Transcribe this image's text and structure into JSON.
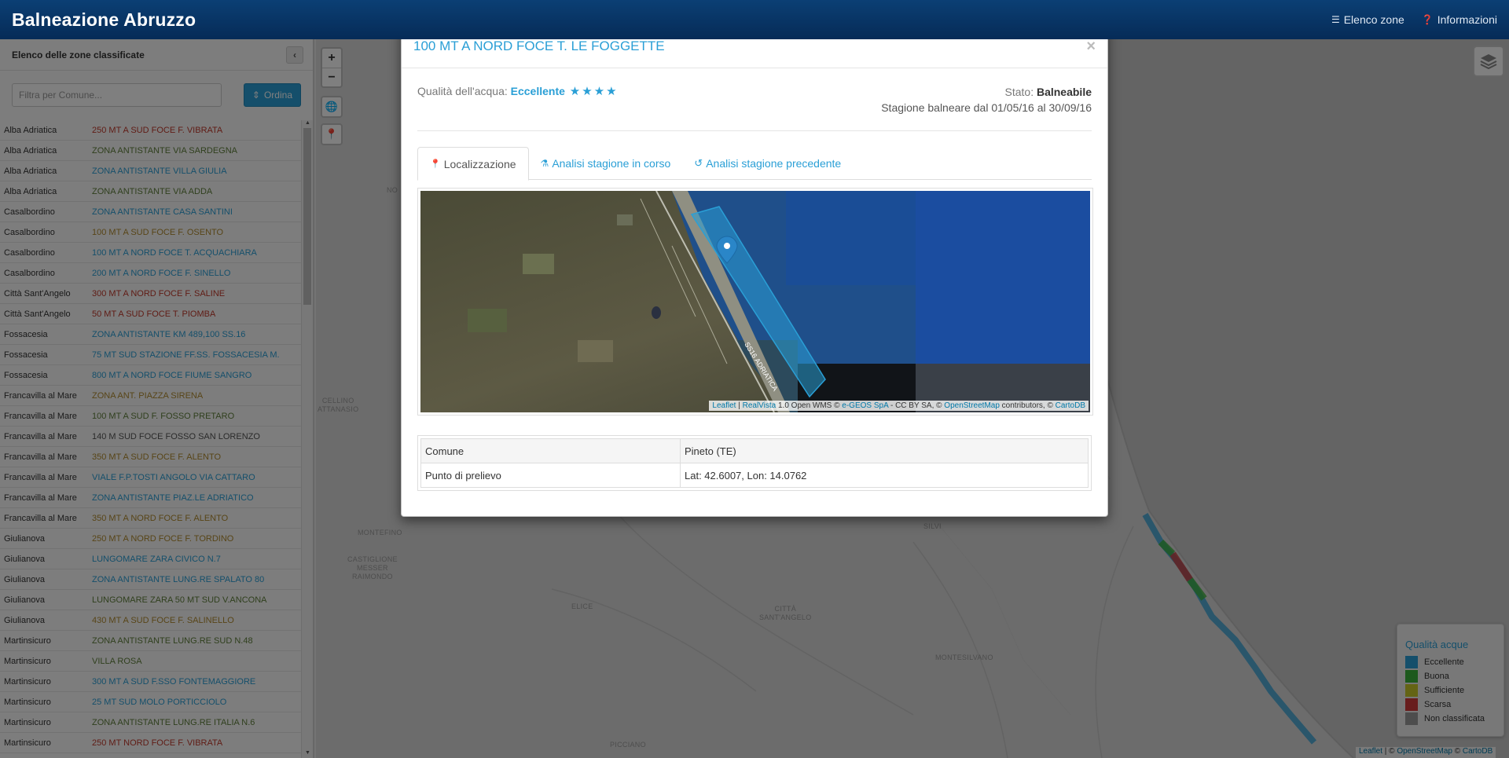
{
  "navbar": {
    "brand": "Balneazione Abruzzo",
    "elenco_zone": "Elenco zone",
    "informazioni": "Informazioni"
  },
  "sidebar": {
    "title": "Elenco delle zone classificate",
    "filter_placeholder": "Filtra per Comune...",
    "sort_label": "Ordina",
    "rows": [
      {
        "comune": "Alba Adriatica",
        "zona": "250 MT A SUD FOCE F. VIBRATA",
        "color": "#c0392b"
      },
      {
        "comune": "Alba Adriatica",
        "zona": "ZONA ANTISTANTE VIA SARDEGNA",
        "color": "#5f7f3a"
      },
      {
        "comune": "Alba Adriatica",
        "zona": "ZONA ANTISTANTE VILLA GIULIA",
        "color": "#2a9fd6"
      },
      {
        "comune": "Alba Adriatica",
        "zona": "ZONA ANTISTANTE VIA ADDA",
        "color": "#5f7f3a"
      },
      {
        "comune": "Casalbordino",
        "zona": "ZONA ANTISTANTE CASA SANTINI",
        "color": "#2a9fd6"
      },
      {
        "comune": "Casalbordino",
        "zona": "100 MT A SUD FOCE F. OSENTO",
        "color": "#b08a2e"
      },
      {
        "comune": "Casalbordino",
        "zona": "100 MT A NORD FOCE T. ACQUACHIARA",
        "color": "#2a9fd6"
      },
      {
        "comune": "Casalbordino",
        "zona": "200 MT A NORD FOCE F. SINELLO",
        "color": "#2a9fd6"
      },
      {
        "comune": "Città Sant'Angelo",
        "zona": "300 MT A NORD FOCE F. SALINE",
        "color": "#c0392b"
      },
      {
        "comune": "Città Sant'Angelo",
        "zona": "50 MT A SUD FOCE T. PIOMBA",
        "color": "#c0392b"
      },
      {
        "comune": "Fossacesia",
        "zona": "ZONA ANTISTANTE KM 489,100 SS.16",
        "color": "#2a9fd6"
      },
      {
        "comune": "Fossacesia",
        "zona": "75 MT SUD STAZIONE FF.SS. FOSSACESIA M.",
        "color": "#2a9fd6"
      },
      {
        "comune": "Fossacesia",
        "zona": "800 MT A NORD FOCE FIUME SANGRO",
        "color": "#2a9fd6"
      },
      {
        "comune": "Francavilla al Mare",
        "zona": "ZONA ANT. PIAZZA SIRENA",
        "color": "#b08a2e"
      },
      {
        "comune": "Francavilla al Mare",
        "zona": "100 MT A SUD F. FOSSO PRETARO",
        "color": "#5f7f3a"
      },
      {
        "comune": "Francavilla al Mare",
        "zona": "140 M SUD FOCE FOSSO SAN LORENZO",
        "color": "#555555"
      },
      {
        "comune": "Francavilla al Mare",
        "zona": "350 MT A SUD FOCE F. ALENTO",
        "color": "#b08a2e"
      },
      {
        "comune": "Francavilla al Mare",
        "zona": "VIALE F.P.TOSTI ANGOLO VIA CATTARO",
        "color": "#2a9fd6"
      },
      {
        "comune": "Francavilla al Mare",
        "zona": "ZONA ANTISTANTE PIAZ.LE ADRIATICO",
        "color": "#2a9fd6"
      },
      {
        "comune": "Francavilla al Mare",
        "zona": "350 MT A NORD FOCE F. ALENTO",
        "color": "#b08a2e"
      },
      {
        "comune": "Giulianova",
        "zona": "250 MT A NORD FOCE F. TORDINO",
        "color": "#b08a2e"
      },
      {
        "comune": "Giulianova",
        "zona": "LUNGOMARE ZARA CIVICO N.7",
        "color": "#2a9fd6"
      },
      {
        "comune": "Giulianova",
        "zona": "ZONA ANTISTANTE LUNG.RE SPALATO 80",
        "color": "#2a9fd6"
      },
      {
        "comune": "Giulianova",
        "zona": "LUNGOMARE ZARA 50 MT SUD V.ANCONA",
        "color": "#5f7f3a"
      },
      {
        "comune": "Giulianova",
        "zona": "430 MT A SUD FOCE F. SALINELLO",
        "color": "#b08a2e"
      },
      {
        "comune": "Martinsicuro",
        "zona": "ZONA ANTISTANTE LUNG.RE SUD N.48",
        "color": "#5f7f3a"
      },
      {
        "comune": "Martinsicuro",
        "zona": "VILLA ROSA",
        "color": "#5f7f3a"
      },
      {
        "comune": "Martinsicuro",
        "zona": "300 MT A SUD F.SSO FONTEMAGGIORE",
        "color": "#2a9fd6"
      },
      {
        "comune": "Martinsicuro",
        "zona": "25 MT SUD MOLO PORTICCIOLO",
        "color": "#2a9fd6"
      },
      {
        "comune": "Martinsicuro",
        "zona": "ZONA ANTISTANTE LUNG.RE ITALIA N.6",
        "color": "#5f7f3a"
      },
      {
        "comune": "Martinsicuro",
        "zona": "250 MT NORD FOCE F. VIBRATA",
        "color": "#c0392b"
      }
    ]
  },
  "map": {
    "zoom_in": "+",
    "zoom_out": "−",
    "places": {
      "cellino": "CELLINO\nATTANASIO",
      "montefino": "MONTEFINO",
      "castiglione": "CASTIGLIONE\nMESSER\nRAIMONDO",
      "elice": "ELICE",
      "citta_sant_angelo": "CITTÀ\nSANT'ANGELO",
      "montesilvano": "MONTESILVANO",
      "picciano": "PICCIANO",
      "silvi": "SILVI",
      "no": "NO"
    },
    "legend": {
      "title": "Qualità acque",
      "items": [
        {
          "label": "Eccellente",
          "color": "#2a9fd6"
        },
        {
          "label": "Buona",
          "color": "#3bb33b"
        },
        {
          "label": "Sufficiente",
          "color": "#c9c92a"
        },
        {
          "label": "Scarsa",
          "color": "#d03a3a"
        },
        {
          "label": "Non classificata",
          "color": "#9b9b9b"
        }
      ]
    },
    "attribution": {
      "leaflet": "Leaflet",
      "sep1": " | © ",
      "osm": "OpenStreetMap",
      "sep2": " © ",
      "carto": "CartoDB"
    }
  },
  "modal": {
    "title": "100 MT A NORD FOCE T. LE FOGGETTE",
    "close": "×",
    "quality_label": "Qualità dell'acqua: ",
    "quality_value": "Eccellente",
    "stars": 4,
    "stato_label": "Stato: ",
    "stato_value": "Balneabile",
    "season": "Stagione balneare dal 01/05/16 al 30/09/16",
    "tabs": [
      {
        "label": "Localizzazione",
        "icon": "map-marker-icon"
      },
      {
        "label": "Analisi stagione in corso",
        "icon": "flask-icon"
      },
      {
        "label": "Analisi stagione precedente",
        "icon": "history-icon"
      }
    ],
    "map_road_label": "SS16 ADRIATICA",
    "map_attribution": {
      "leaflet": "Leaflet",
      "sep1": " | ",
      "realvista": "RealVista",
      "text1": " 1.0 Open WMS © ",
      "egeos": "e-GEOS SpA",
      "text2": " - CC BY SA, © ",
      "osm": "OpenStreetMap",
      "text3": " contributors, © ",
      "carto": "CartoDB"
    },
    "table": [
      {
        "key": "Comune",
        "value": "Pineto (TE)"
      },
      {
        "key": "Punto di prelievo",
        "value": "Lat: 42.6007, Lon: 14.0762"
      }
    ]
  }
}
